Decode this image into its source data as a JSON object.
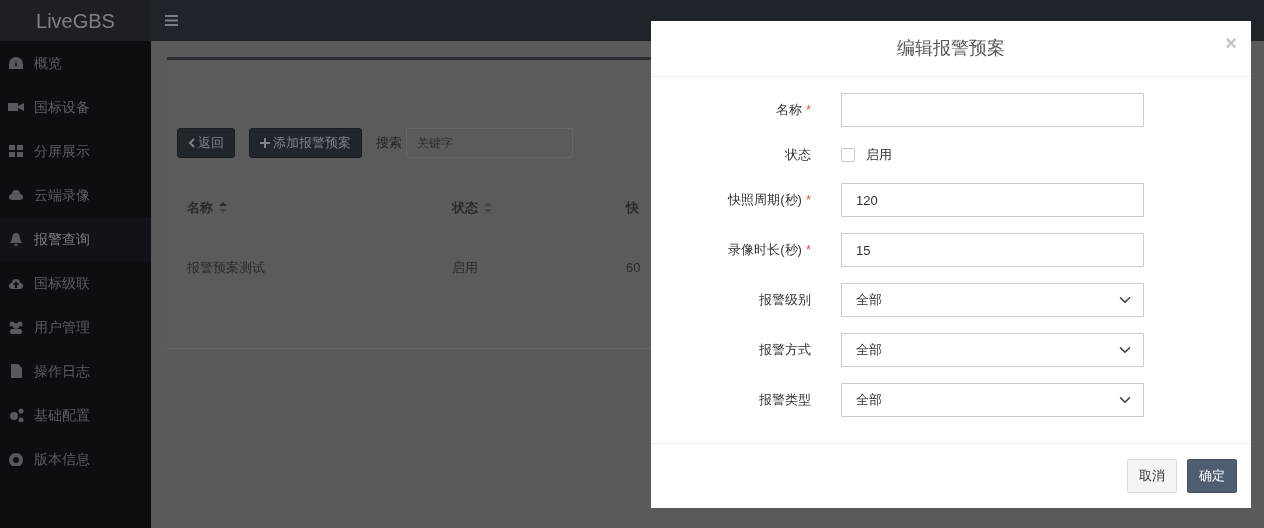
{
  "brand": "LiveGBS",
  "sidebar": {
    "items": [
      {
        "label": "概览",
        "selected": false
      },
      {
        "label": "国标设备",
        "selected": false
      },
      {
        "label": "分屏展示",
        "selected": false
      },
      {
        "label": "云端录像",
        "selected": false
      },
      {
        "label": "报警查询",
        "selected": true
      },
      {
        "label": "国标级联",
        "selected": false
      },
      {
        "label": "用户管理",
        "selected": false
      },
      {
        "label": "操作日志",
        "selected": false
      },
      {
        "label": "基础配置",
        "selected": false
      },
      {
        "label": "版本信息",
        "selected": false
      }
    ]
  },
  "toolbar": {
    "back_button": "返回",
    "add_button": "添加报警预案",
    "search_label": "搜索",
    "search": {
      "placeholder": "关键字"
    }
  },
  "table": {
    "columns": [
      "名称",
      "状态",
      "快"
    ],
    "rows": [
      [
        "报警预案测试",
        "启用",
        "60"
      ]
    ]
  },
  "modal": {
    "title": "编辑报警预案",
    "close": "×",
    "fields": [
      {
        "kind": "text",
        "label": "名称",
        "mark": "*"
      },
      {
        "kind": "checkbox",
        "label": "状态",
        "option": "启用",
        "checked": false
      },
      {
        "kind": "text",
        "label": "快照周期(秒)",
        "mark": "*",
        "value": "120"
      },
      {
        "kind": "text",
        "label": "录像时长(秒)",
        "mark": "*",
        "value": "15"
      },
      {
        "kind": "select",
        "label": "报警级别",
        "value": "全部"
      },
      {
        "kind": "select",
        "label": "报警方式",
        "value": "全部"
      },
      {
        "kind": "select",
        "label": "报警类型",
        "value": "全部"
      }
    ],
    "buttons": [
      {
        "label": "取消",
        "kind": "secondary"
      },
      {
        "label": "确定",
        "kind": "primary"
      }
    ]
  }
}
